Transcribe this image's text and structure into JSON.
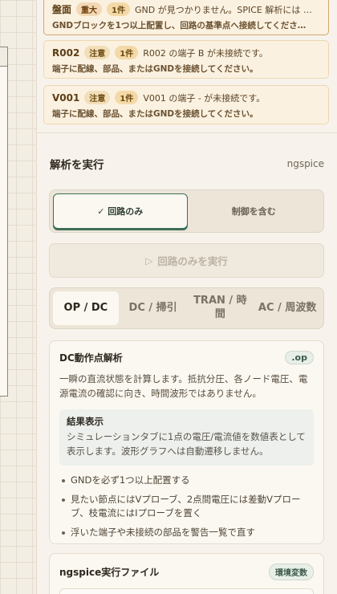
{
  "issues": [
    {
      "code": "盤面",
      "severity": "重大",
      "count": "1件",
      "message": "GND が見つかりません。SPICE 解析には …",
      "hint": "GNDブロックを1つ以上配置し、回路の基準点へ接続してくださ…"
    },
    {
      "code": "R002",
      "severity": "注意",
      "count": "1件",
      "message": "R002 の端子 B が未接続です。",
      "hint": "端子に配線、部品、またはGNDを接続してください。"
    },
    {
      "code": "V001",
      "severity": "注意",
      "count": "1件",
      "message": "V001 の端子 - が未接続です。",
      "hint": "端子に配線、部品、またはGNDを接続してください。"
    }
  ],
  "analysis": {
    "title": "解析を実行",
    "engine": "ngspice",
    "mode_options": [
      "✓ 回路のみ",
      "制御を含む"
    ],
    "run_label": "回路のみを実行",
    "run_icon": "▷",
    "tabs": [
      "OP / DC",
      "DC / 掃引",
      "TRAN / 時間",
      "AC / 周波数"
    ],
    "active_tab": "OP / DC"
  },
  "op_card": {
    "title": "DC動作点解析",
    "badge": ".op",
    "description": "一瞬の直流状態を計算します。抵抗分圧、各ノード電圧、電源電流の確認に向き、時間波形ではありません。",
    "result_title": "結果表示",
    "result_desc": "シミュレーションタブに1点の電圧/電流値を数値表として表示します。波形グラフへは自動遷移しません。",
    "tips": [
      "GNDを必ず1つ以上配置する",
      "見たい節点にはVプローブ、2点間電圧には差動Vプローブ、枝電流にはIプローブを置く",
      "浮いた端子や未接続の部品を警告一覧で直す"
    ]
  },
  "exec_card": {
    "title": "ngspice実行ファイル",
    "badge": "環境変数"
  },
  "colors": {
    "accent": "#3f6e58",
    "warning_bg": "#fbf1e0",
    "panel_bg": "#f7f3ec"
  }
}
